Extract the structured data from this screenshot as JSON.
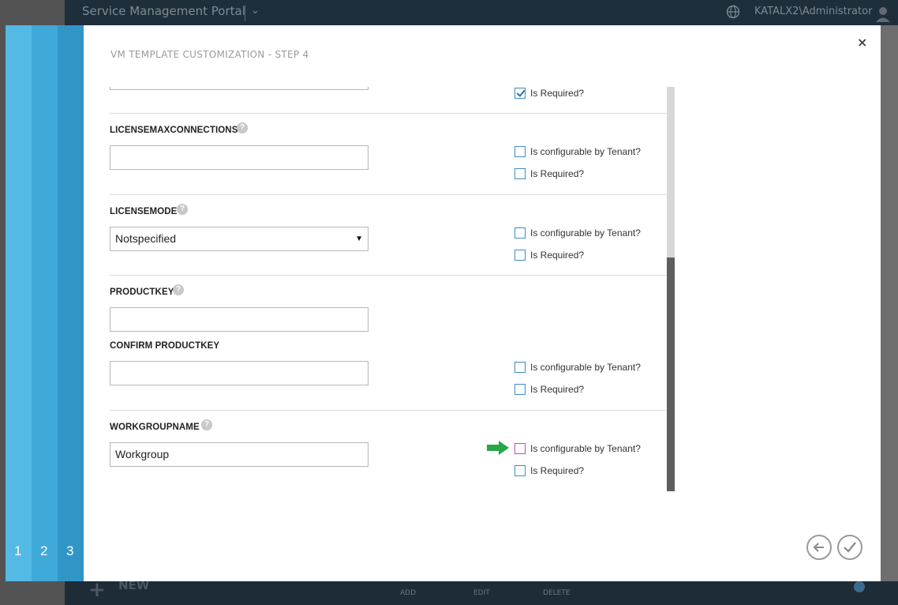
{
  "portal": {
    "title": "Service Management Portal",
    "user": "KATALX2\\Administrator",
    "bottom_new": "NEW",
    "bottom_actions": [
      "ADD",
      "EDIT",
      "DELETE"
    ]
  },
  "wizard": {
    "steps": [
      "1",
      "2",
      "3"
    ],
    "title": "VM TEMPLATE CUSTOMIZATION - STEP 4",
    "close_glyph": "×",
    "checkbox_labels": {
      "configurable": "Is configurable by Tenant?",
      "required": "Is Required?"
    },
    "fields": [
      {
        "name": "LICENSEMAXCONNECTIONS",
        "value": ""
      },
      {
        "name": "LICENSEMODE",
        "value": "Notspecified"
      },
      {
        "name": "PRODUCTKEY",
        "value": "",
        "confirm_label": "CONFIRM PRODUCTKEY",
        "confirm_value": ""
      },
      {
        "name": "WORKGROUPNAME",
        "value": "Workgroup"
      }
    ],
    "help_glyph": "?",
    "select_arrow": "▼"
  },
  "colors": {
    "accent": "#3196c6",
    "checkbox_border": "#3c8dc0",
    "highlight_checkbox": "#c046c5",
    "pointer_arrow": "#27a84a"
  },
  "icons": [
    "globe-icon",
    "avatar-icon",
    "help-icon",
    "close-icon",
    "back-arrow-icon",
    "check-icon",
    "green-arrow-icon"
  ]
}
